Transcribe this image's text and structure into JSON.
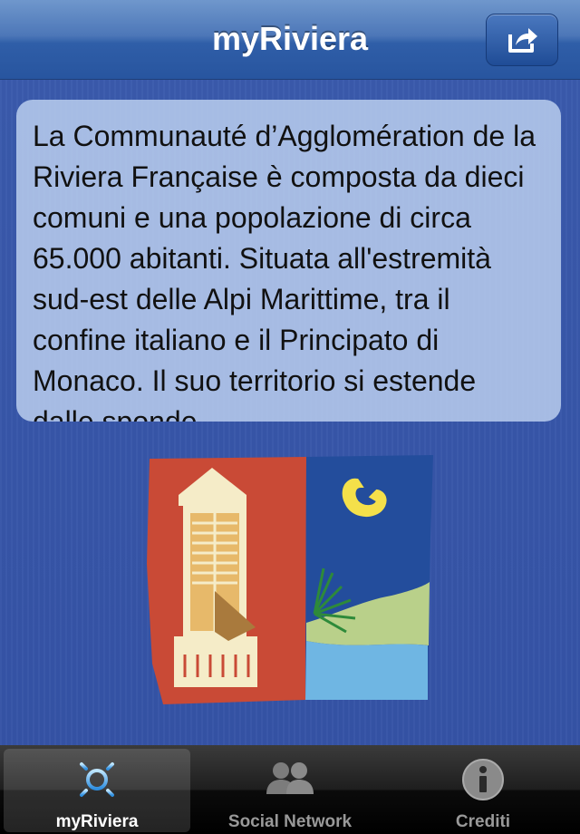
{
  "navbar": {
    "title": "myRiviera",
    "share_icon": "share-icon"
  },
  "content": {
    "description": "La Communauté d’Agglomération de la Riviera Française è composta da dieci comuni e una popolazione di circa 65.000 abitanti. Situata all'estremità sud-est delle Alpi Marittime, tra il confine italiano e il Principato di Monaco. Il suo territorio si estende dalle sponde",
    "logo_icon": "riviera-logo-icon"
  },
  "tabbar": {
    "tabs": [
      {
        "label": "myRiviera",
        "icon": "sun-icon",
        "selected": true
      },
      {
        "label": "Social Network",
        "icon": "people-icon",
        "selected": false
      },
      {
        "label": "Crediti",
        "icon": "info-icon",
        "selected": false
      }
    ]
  },
  "colors": {
    "background": "#3553a6",
    "logo_red": "#c94a36",
    "logo_blue": "#234d9c",
    "logo_yellow": "#f4e04a",
    "logo_light_blue": "#6fb6e3",
    "logo_green": "#b9d08a"
  }
}
